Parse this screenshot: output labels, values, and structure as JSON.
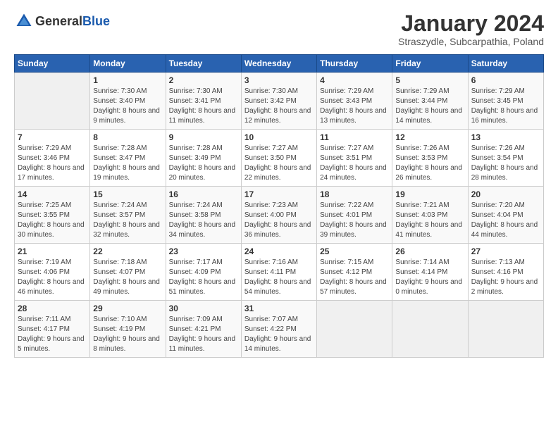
{
  "header": {
    "logo_general": "General",
    "logo_blue": "Blue",
    "month_title": "January 2024",
    "location": "Straszydle, Subcarpathia, Poland"
  },
  "days_of_week": [
    "Sunday",
    "Monday",
    "Tuesday",
    "Wednesday",
    "Thursday",
    "Friday",
    "Saturday"
  ],
  "weeks": [
    [
      {
        "day": "",
        "sunrise": "",
        "sunset": "",
        "daylight": ""
      },
      {
        "day": "1",
        "sunrise": "Sunrise: 7:30 AM",
        "sunset": "Sunset: 3:40 PM",
        "daylight": "Daylight: 8 hours and 9 minutes."
      },
      {
        "day": "2",
        "sunrise": "Sunrise: 7:30 AM",
        "sunset": "Sunset: 3:41 PM",
        "daylight": "Daylight: 8 hours and 11 minutes."
      },
      {
        "day": "3",
        "sunrise": "Sunrise: 7:30 AM",
        "sunset": "Sunset: 3:42 PM",
        "daylight": "Daylight: 8 hours and 12 minutes."
      },
      {
        "day": "4",
        "sunrise": "Sunrise: 7:29 AM",
        "sunset": "Sunset: 3:43 PM",
        "daylight": "Daylight: 8 hours and 13 minutes."
      },
      {
        "day": "5",
        "sunrise": "Sunrise: 7:29 AM",
        "sunset": "Sunset: 3:44 PM",
        "daylight": "Daylight: 8 hours and 14 minutes."
      },
      {
        "day": "6",
        "sunrise": "Sunrise: 7:29 AM",
        "sunset": "Sunset: 3:45 PM",
        "daylight": "Daylight: 8 hours and 16 minutes."
      }
    ],
    [
      {
        "day": "7",
        "sunrise": "Sunrise: 7:29 AM",
        "sunset": "Sunset: 3:46 PM",
        "daylight": "Daylight: 8 hours and 17 minutes."
      },
      {
        "day": "8",
        "sunrise": "Sunrise: 7:28 AM",
        "sunset": "Sunset: 3:47 PM",
        "daylight": "Daylight: 8 hours and 19 minutes."
      },
      {
        "day": "9",
        "sunrise": "Sunrise: 7:28 AM",
        "sunset": "Sunset: 3:49 PM",
        "daylight": "Daylight: 8 hours and 20 minutes."
      },
      {
        "day": "10",
        "sunrise": "Sunrise: 7:27 AM",
        "sunset": "Sunset: 3:50 PM",
        "daylight": "Daylight: 8 hours and 22 minutes."
      },
      {
        "day": "11",
        "sunrise": "Sunrise: 7:27 AM",
        "sunset": "Sunset: 3:51 PM",
        "daylight": "Daylight: 8 hours and 24 minutes."
      },
      {
        "day": "12",
        "sunrise": "Sunrise: 7:26 AM",
        "sunset": "Sunset: 3:53 PM",
        "daylight": "Daylight: 8 hours and 26 minutes."
      },
      {
        "day": "13",
        "sunrise": "Sunrise: 7:26 AM",
        "sunset": "Sunset: 3:54 PM",
        "daylight": "Daylight: 8 hours and 28 minutes."
      }
    ],
    [
      {
        "day": "14",
        "sunrise": "Sunrise: 7:25 AM",
        "sunset": "Sunset: 3:55 PM",
        "daylight": "Daylight: 8 hours and 30 minutes."
      },
      {
        "day": "15",
        "sunrise": "Sunrise: 7:24 AM",
        "sunset": "Sunset: 3:57 PM",
        "daylight": "Daylight: 8 hours and 32 minutes."
      },
      {
        "day": "16",
        "sunrise": "Sunrise: 7:24 AM",
        "sunset": "Sunset: 3:58 PM",
        "daylight": "Daylight: 8 hours and 34 minutes."
      },
      {
        "day": "17",
        "sunrise": "Sunrise: 7:23 AM",
        "sunset": "Sunset: 4:00 PM",
        "daylight": "Daylight: 8 hours and 36 minutes."
      },
      {
        "day": "18",
        "sunrise": "Sunrise: 7:22 AM",
        "sunset": "Sunset: 4:01 PM",
        "daylight": "Daylight: 8 hours and 39 minutes."
      },
      {
        "day": "19",
        "sunrise": "Sunrise: 7:21 AM",
        "sunset": "Sunset: 4:03 PM",
        "daylight": "Daylight: 8 hours and 41 minutes."
      },
      {
        "day": "20",
        "sunrise": "Sunrise: 7:20 AM",
        "sunset": "Sunset: 4:04 PM",
        "daylight": "Daylight: 8 hours and 44 minutes."
      }
    ],
    [
      {
        "day": "21",
        "sunrise": "Sunrise: 7:19 AM",
        "sunset": "Sunset: 4:06 PM",
        "daylight": "Daylight: 8 hours and 46 minutes."
      },
      {
        "day": "22",
        "sunrise": "Sunrise: 7:18 AM",
        "sunset": "Sunset: 4:07 PM",
        "daylight": "Daylight: 8 hours and 49 minutes."
      },
      {
        "day": "23",
        "sunrise": "Sunrise: 7:17 AM",
        "sunset": "Sunset: 4:09 PM",
        "daylight": "Daylight: 8 hours and 51 minutes."
      },
      {
        "day": "24",
        "sunrise": "Sunrise: 7:16 AM",
        "sunset": "Sunset: 4:11 PM",
        "daylight": "Daylight: 8 hours and 54 minutes."
      },
      {
        "day": "25",
        "sunrise": "Sunrise: 7:15 AM",
        "sunset": "Sunset: 4:12 PM",
        "daylight": "Daylight: 8 hours and 57 minutes."
      },
      {
        "day": "26",
        "sunrise": "Sunrise: 7:14 AM",
        "sunset": "Sunset: 4:14 PM",
        "daylight": "Daylight: 9 hours and 0 minutes."
      },
      {
        "day": "27",
        "sunrise": "Sunrise: 7:13 AM",
        "sunset": "Sunset: 4:16 PM",
        "daylight": "Daylight: 9 hours and 2 minutes."
      }
    ],
    [
      {
        "day": "28",
        "sunrise": "Sunrise: 7:11 AM",
        "sunset": "Sunset: 4:17 PM",
        "daylight": "Daylight: 9 hours and 5 minutes."
      },
      {
        "day": "29",
        "sunrise": "Sunrise: 7:10 AM",
        "sunset": "Sunset: 4:19 PM",
        "daylight": "Daylight: 9 hours and 8 minutes."
      },
      {
        "day": "30",
        "sunrise": "Sunrise: 7:09 AM",
        "sunset": "Sunset: 4:21 PM",
        "daylight": "Daylight: 9 hours and 11 minutes."
      },
      {
        "day": "31",
        "sunrise": "Sunrise: 7:07 AM",
        "sunset": "Sunset: 4:22 PM",
        "daylight": "Daylight: 9 hours and 14 minutes."
      },
      {
        "day": "",
        "sunrise": "",
        "sunset": "",
        "daylight": ""
      },
      {
        "day": "",
        "sunrise": "",
        "sunset": "",
        "daylight": ""
      },
      {
        "day": "",
        "sunrise": "",
        "sunset": "",
        "daylight": ""
      }
    ]
  ]
}
